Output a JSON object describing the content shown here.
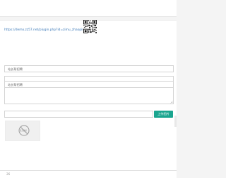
{
  "link": {
    "text": "https://demo.zz57.net/plugin.php?id=zimu_zhaopin"
  },
  "form": {
    "field1_placeholder": "站长帮招聘",
    "field2_placeholder": "站长帮招聘",
    "textarea_value": "",
    "upload_value": ""
  },
  "upload": {
    "button_label": "上传图片"
  },
  "preview": {
    "label": "暂无图片"
  },
  "footer": {
    "text": "26"
  },
  "colors": {
    "accent": "#1aa58f",
    "link": "#3a78b8"
  }
}
